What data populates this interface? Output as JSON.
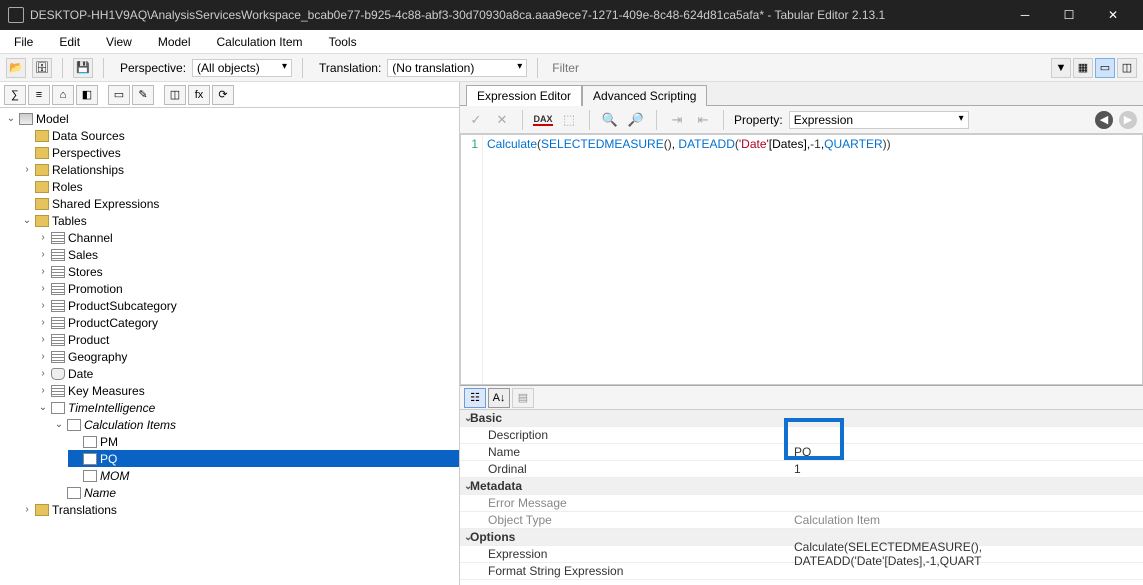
{
  "window": {
    "title": "DESKTOP-HH1V9AQ\\AnalysisServicesWorkspace_bcab0e77-b925-4c88-abf3-30d70930a8ca.aaa9ece7-1271-409e-8c48-624d81ca5afa* - Tabular Editor 2.13.1"
  },
  "menu": [
    "File",
    "Edit",
    "View",
    "Model",
    "Calculation Item",
    "Tools"
  ],
  "toolbar": {
    "perspective_label": "Perspective:",
    "perspective_value": "(All objects)",
    "translation_label": "Translation:",
    "translation_value": "(No translation)",
    "filter_placeholder": "Filter"
  },
  "tree": {
    "root": "Model",
    "data_sources": "Data Sources",
    "perspectives": "Perspectives",
    "relationships": "Relationships",
    "roles": "Roles",
    "shared_expr": "Shared Expressions",
    "tables": "Tables",
    "table_list": [
      "Channel",
      "Sales",
      "Stores",
      "Promotion",
      "ProductSubcategory",
      "ProductCategory",
      "Product",
      "Geography",
      "Date",
      "Key Measures"
    ],
    "time_intel": "TimeIntelligence",
    "calc_items": "Calculation Items",
    "items": [
      "PM",
      "PQ",
      "MOM"
    ],
    "name_col": "Name",
    "translations": "Translations"
  },
  "tabs": {
    "editor": "Expression Editor",
    "script": "Advanced Scripting"
  },
  "editorToolbar": {
    "property_label": "Property:",
    "property_value": "Expression"
  },
  "code": {
    "line_no": "1",
    "raw": "Calculate(SELECTEDMEASURE(), DATEADD('Date'[Dates],-1,QUARTER))"
  },
  "props": {
    "basic": "Basic",
    "description": "Description",
    "name_label": "Name",
    "name_value": "PQ",
    "ordinal_label": "Ordinal",
    "ordinal_value": "1",
    "metadata": "Metadata",
    "error_msg": "Error Message",
    "object_type_label": "Object Type",
    "object_type_value": "Calculation Item",
    "options": "Options",
    "expression_label": "Expression",
    "expression_value": "Calculate(SELECTEDMEASURE(), DATEADD('Date'[Dates],-1,QUART",
    "format_label": "Format String Expression"
  }
}
